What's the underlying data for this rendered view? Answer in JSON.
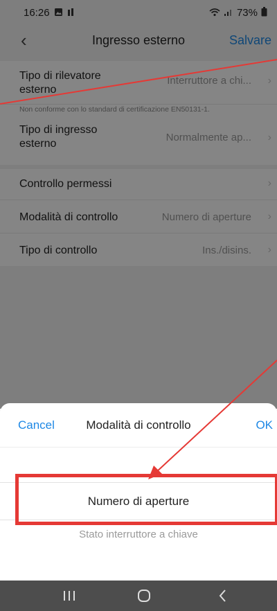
{
  "status_bar": {
    "time": "16:26",
    "battery": "73%",
    "icons": [
      "gallery-icon",
      "signal-icon",
      "wifi-icon",
      "cellular-icon",
      "battery-icon"
    ]
  },
  "nav": {
    "back_icon": "chevron-left-icon",
    "title": "Ingresso esterno",
    "save_label": "Salvare"
  },
  "settings": {
    "detector_type": {
      "label": "Tipo di rilevatore esterno",
      "value": "Interruttore a chi..."
    },
    "certification_note": "Non conforme con lo standard di certificazione EN50131-1.",
    "input_type": {
      "label": "Tipo di ingresso esterno",
      "value": "Normalmente ap..."
    },
    "permission_control": {
      "label": "Controllo permessi"
    },
    "control_mode": {
      "label": "Modalità di controllo",
      "value": "Numero di aperture"
    },
    "control_type": {
      "label": "Tipo di controllo",
      "value": "Ins./disins."
    }
  },
  "sheet": {
    "cancel_label": "Cancel",
    "title": "Modalità di controllo",
    "ok_label": "OK",
    "options": [
      "Numero di aperture",
      "Stato interruttore a chiave"
    ],
    "selected_option": "Numero di aperture"
  },
  "system_nav": {
    "recent_icon": "recent-apps-icon",
    "home_icon": "home-icon",
    "back_icon": "back-icon"
  },
  "colors": {
    "accent": "#1e88e5",
    "annotation": "#e53935",
    "nav_bar": "#4d4d4d"
  }
}
